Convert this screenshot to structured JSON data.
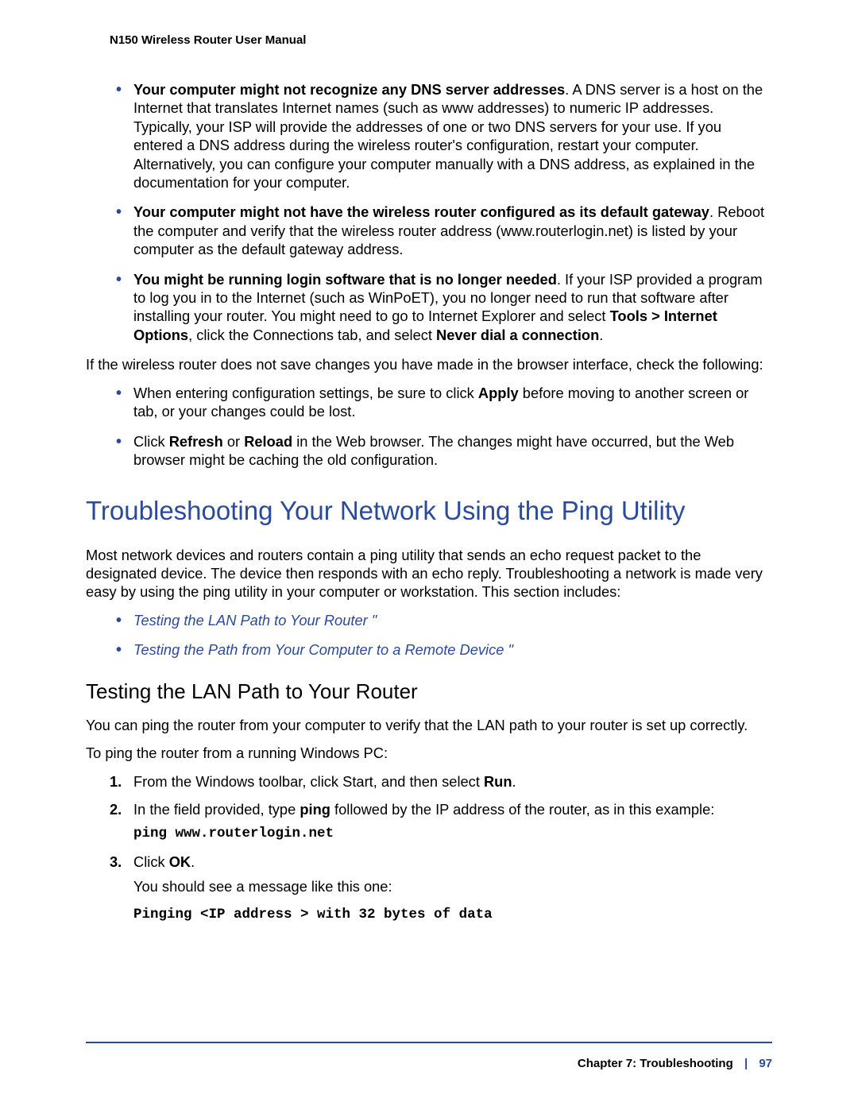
{
  "header": {
    "title": "N150 Wireless Router User Manual"
  },
  "bullet_list1": [
    {
      "bold_lead": "Your computer might not recognize any DNS server addresses",
      "rest": ". A DNS server is a host on the Internet that translates Internet names (such as www addresses) to numeric IP addresses. Typically, your ISP will provide the addresses of one or two DNS servers for your use. If you entered a DNS address during the wireless router's configuration, restart your computer. Alternatively, you can configure your computer manually with a DNS address, as explained in the documentation for your computer."
    },
    {
      "bold_lead": "Your computer might not have the wireless router configured as its default gateway",
      "rest": ". Reboot the computer and verify that the wireless router address (www.routerlogin.net) is listed by your computer as the default gateway address."
    },
    {
      "bold_lead": "You might be running login software that is no longer needed",
      "rest1": ". If your ISP provided a program to log you in to the Internet (such as WinPoET), you no longer need to run that software after installing your router. You might need to go to Internet Explorer and select ",
      "bold_mid1": "Tools > Internet Options",
      "rest2": ", click the Connections tab, and select ",
      "bold_mid2": "Never dial a connection",
      "rest3": "."
    }
  ],
  "para_after_list1": "If the wireless router does not save changes you have made in the browser interface, check the following:",
  "bullet_list2": [
    {
      "pre": "When entering configuration settings, be sure to click ",
      "bold1": "Apply",
      "post": " before moving to another screen or tab, or your changes could be lost."
    },
    {
      "pre": "Click ",
      "bold1": "Refresh",
      "mid": " or ",
      "bold2": "Reload",
      "post": " in the Web browser. The changes might have occurred, but the Web browser might be caching the old configuration."
    }
  ],
  "section": {
    "title": "Troubleshooting Your Network Using the Ping Utility",
    "intro": "Most network devices and routers contain a ping utility that sends an echo request packet to the designated device. The device then responds with an echo reply. Troubleshooting a network is made very easy by using the ping utility in your computer or workstation. This section includes:",
    "links": [
      "Testing the LAN Path to Your Router \"",
      "Testing the Path from Your Computer to a Remote Device \""
    ]
  },
  "sub1": {
    "title": "Testing the LAN Path to Your Router",
    "p1": "You can ping the router from your computer to verify that the LAN path to your router is set up correctly.",
    "p2": "To ping the router from a running Windows PC:",
    "steps": {
      "s1_pre": "From the Windows toolbar, click Start, and then select ",
      "s1_bold": "Run",
      "s1_post": ".",
      "s2_pre": "In the field provided, type ",
      "s2_bold": "ping",
      "s2_post": " followed by the IP address of the router, as in this example:",
      "s2_code": "ping www.routerlogin.net",
      "s3_pre": "Click ",
      "s3_bold": "OK",
      "s3_post": ".",
      "s3_p1": "You should see a message like this one:",
      "s3_code": "Pinging <IP address > with 32 bytes of data"
    }
  },
  "footer": {
    "chapter": "Chapter 7:  Troubleshooting",
    "page": "97"
  }
}
